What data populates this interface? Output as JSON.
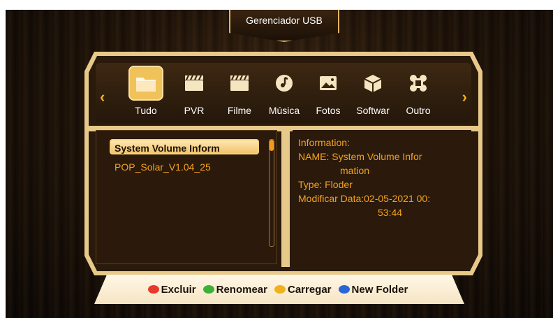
{
  "title": "Gerenciador USB",
  "categories": [
    {
      "label": "Tudo",
      "icon": "folder-icon",
      "selected": true
    },
    {
      "label": "PVR",
      "icon": "clapperboard-icon"
    },
    {
      "label": "Filme",
      "icon": "clapperboard-icon"
    },
    {
      "label": "Música",
      "icon": "music-note-icon"
    },
    {
      "label": "Fotos",
      "icon": "picture-icon"
    },
    {
      "label": "Softwar",
      "icon": "package-icon"
    },
    {
      "label": "Outro",
      "icon": "command-icon"
    }
  ],
  "nav": {
    "left": "‹",
    "right": "›"
  },
  "files": [
    "System Volume Inform",
    "POP_Solar_V1.04_25"
  ],
  "info": {
    "line1": "Information:",
    "line2": "NAME: System Volume Infor",
    "line3": "mation",
    "line4": "Type: Floder",
    "line5": "Modificar Data:02-05-2021 00:",
    "line6": "53:44"
  },
  "help": [
    {
      "label": "Excluir",
      "color": "#e53a2d"
    },
    {
      "label": "Renomear",
      "color": "#3bb236"
    },
    {
      "label": "Carregar",
      "color": "#f0b21c"
    },
    {
      "label": "New Folder",
      "color": "#2a66d8"
    }
  ],
  "colors": {
    "accent": "#f3a21d",
    "frame": "#e7c98a"
  }
}
